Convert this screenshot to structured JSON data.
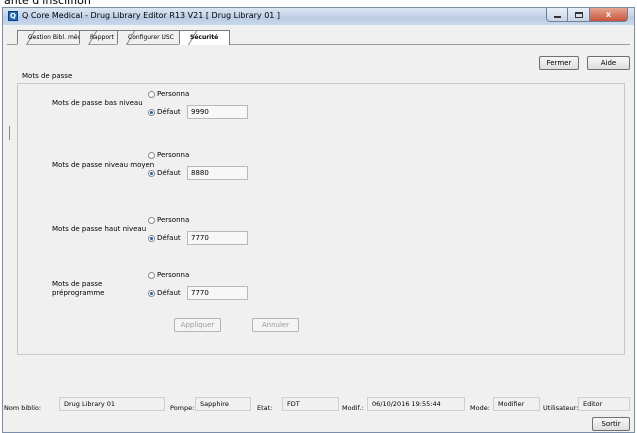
{
  "window": {
    "title": "Q Core Medical - Drug Library Editor R13 V21 [ Drug Library 01 ]",
    "app_icon_glyph": "Q",
    "controls": {
      "minimize": "minimize-icon",
      "maximize": "maximize-icon",
      "close": "x"
    }
  },
  "tabs": [
    {
      "label": "Gestion Bibl. médic.",
      "active": false
    },
    {
      "label": "Rapport",
      "active": false
    },
    {
      "label": "Configurer USC",
      "active": false
    },
    {
      "label": "Sécurité",
      "active": true
    }
  ],
  "toolbar": {
    "close_label": "Fermer",
    "help_label": "Aide"
  },
  "passwords": {
    "group_title": "Mots de passe",
    "rows": [
      {
        "label": "Mots de passe bas niveau",
        "custom_label": "Personna",
        "default_label": "Défaut",
        "value": "9990",
        "selected": "default"
      },
      {
        "label": "Mots de passe niveau moyen",
        "custom_label": "Personna",
        "default_label": "Défaut",
        "value": "8880",
        "selected": "default"
      },
      {
        "label": "Mots de passe haut niveau",
        "custom_label": "Personna",
        "default_label": "Défaut",
        "value": "7770",
        "selected": "default"
      },
      {
        "label_line1": "Mots de passe",
        "label_line2": "préprogramme",
        "custom_label": "Personna",
        "default_label": "Défaut",
        "value": "7770",
        "selected": "default"
      }
    ],
    "apply_label": "Appliquer",
    "cancel_label": "Annuler"
  },
  "status": {
    "library_label": "Nom biblio:",
    "library_value": "Drug Library 01",
    "pump_label": "Pompe:",
    "pump_value": "Sapphire",
    "state_label": "Etat:",
    "state_value": "FDT",
    "modified_label": "Modif.:",
    "modified_value": "06/10/2016 19:55:44",
    "mode_label": "Mode:",
    "mode_value": "Modifier",
    "user_label": "Utilisateur:",
    "user_value": "Editor"
  },
  "exit_label": "Sortir",
  "colors": {
    "selected_radio": "#1d5fb4",
    "window_border": "#7a8ea8",
    "close_button": "#c9553a"
  }
}
